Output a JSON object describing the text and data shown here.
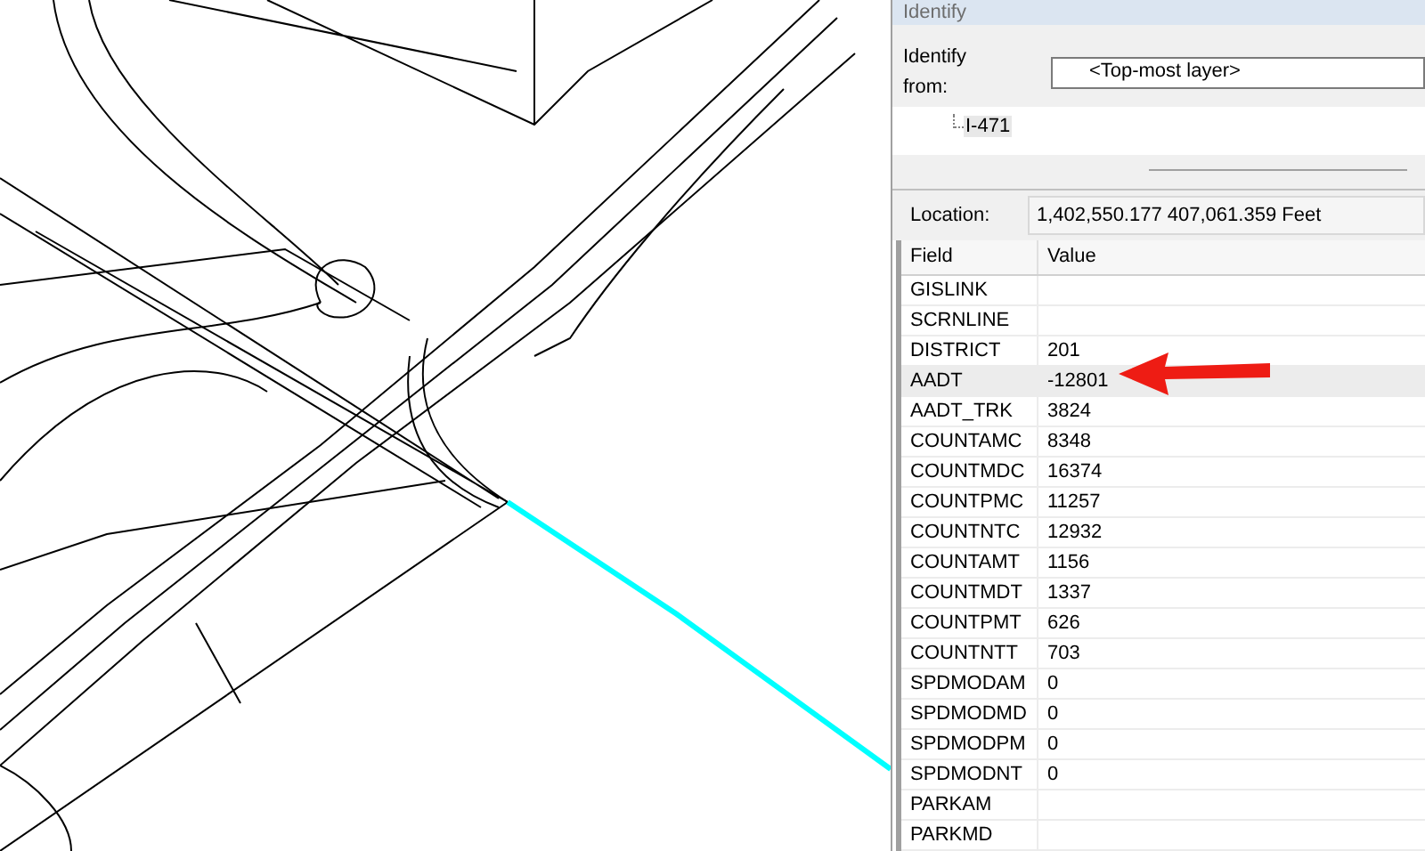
{
  "panel": {
    "title": "Identify",
    "identify_from": {
      "label": "Identify from:",
      "value": "<Top-most layer>"
    },
    "tree": [
      {
        "label": "I-471",
        "selected": true
      }
    ],
    "location": {
      "label": "Location:",
      "value": "1,402,550.177  407,061.359 Feet"
    },
    "table": {
      "columns": [
        "Field",
        "Value"
      ],
      "rows": [
        {
          "field": "GISLINK",
          "value": "",
          "selected": false
        },
        {
          "field": "SCRNLINE",
          "value": "",
          "selected": false
        },
        {
          "field": "DISTRICT",
          "value": "201",
          "selected": false
        },
        {
          "field": "AADT",
          "value": "-12801",
          "selected": true
        },
        {
          "field": "AADT_TRK",
          "value": "3824",
          "selected": false
        },
        {
          "field": "COUNTAMC",
          "value": "8348",
          "selected": false
        },
        {
          "field": "COUNTMDC",
          "value": "16374",
          "selected": false
        },
        {
          "field": "COUNTPMC",
          "value": "11257",
          "selected": false
        },
        {
          "field": "COUNTNTC",
          "value": "12932",
          "selected": false
        },
        {
          "field": "COUNTAMT",
          "value": "1156",
          "selected": false
        },
        {
          "field": "COUNTMDT",
          "value": "1337",
          "selected": false
        },
        {
          "field": "COUNTPMT",
          "value": "626",
          "selected": false
        },
        {
          "field": "COUNTNTT",
          "value": "703",
          "selected": false
        },
        {
          "field": "SPDMODAM",
          "value": "0",
          "selected": false
        },
        {
          "field": "SPDMODMD",
          "value": "0",
          "selected": false
        },
        {
          "field": "SPDMODPM",
          "value": "0",
          "selected": false
        },
        {
          "field": "SPDMODNT",
          "value": "0",
          "selected": false
        },
        {
          "field": "PARKAM",
          "value": "",
          "selected": false
        },
        {
          "field": "PARKMD",
          "value": "",
          "selected": false
        }
      ]
    }
  }
}
